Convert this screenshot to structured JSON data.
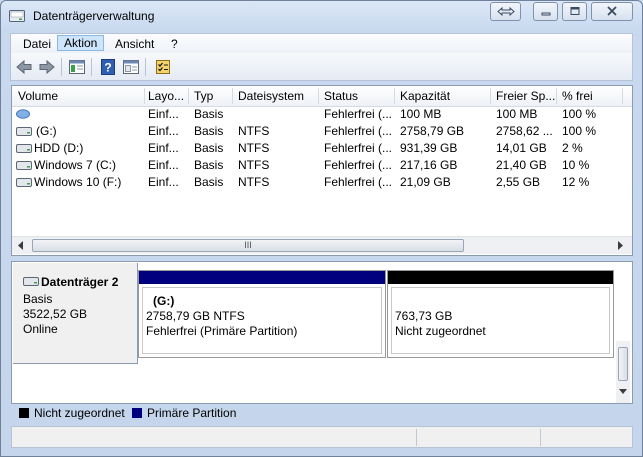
{
  "window": {
    "title": "Datenträgerverwaltung"
  },
  "menu": [
    "Datei",
    "Aktion",
    "Ansicht",
    "?"
  ],
  "volume_table": {
    "columns": [
      "Volume",
      "Layo...",
      "Typ",
      "Dateisystem",
      "Status",
      "Kapazität",
      "Freier Sp...",
      "% frei"
    ],
    "rows": [
      {
        "volume": "",
        "layout": "Einf...",
        "typ": "Basis",
        "fs": "",
        "status": "Fehlerfrei (...",
        "kap": "100 MB",
        "frei": "100 MB",
        "pct": "100 %"
      },
      {
        "volume": "(G:)",
        "layout": "Einf...",
        "typ": "Basis",
        "fs": "NTFS",
        "status": "Fehlerfrei (...",
        "kap": "2758,79 GB",
        "frei": "2758,62 ...",
        "pct": "100 %"
      },
      {
        "volume": "HDD (D:)",
        "layout": "Einf...",
        "typ": "Basis",
        "fs": "NTFS",
        "status": "Fehlerfrei (...",
        "kap": "931,39 GB",
        "frei": "14,01 GB",
        "pct": "2 %"
      },
      {
        "volume": "Windows 7 (C:)",
        "layout": "Einf...",
        "typ": "Basis",
        "fs": "NTFS",
        "status": "Fehlerfrei (...",
        "kap": "217,16 GB",
        "frei": "21,40 GB",
        "pct": "10 %"
      },
      {
        "volume": "Windows 10 (F:)",
        "layout": "Einf...",
        "typ": "Basis",
        "fs": "NTFS",
        "status": "Fehlerfrei (...",
        "kap": "21,09 GB",
        "frei": "2,55 GB",
        "pct": "12 %"
      }
    ],
    "hscroll_label": "III"
  },
  "disk": {
    "name": "Datenträger 2",
    "type": "Basis",
    "size": "3522,52 GB",
    "state": "Online",
    "partitions": [
      {
        "name": "(G:)",
        "line1": "2758,79 GB NTFS",
        "line2": "Fehlerfrei (Primäre Partition)",
        "color": "#00007f"
      },
      {
        "name": "",
        "line1": "763,73 GB",
        "line2": "Nicht zugeordnet",
        "color": "#000000"
      }
    ]
  },
  "legend": [
    {
      "label": "Nicht zugeordnet",
      "color": "#000000"
    },
    {
      "label": "Primäre Partition",
      "color": "#00007f"
    }
  ]
}
